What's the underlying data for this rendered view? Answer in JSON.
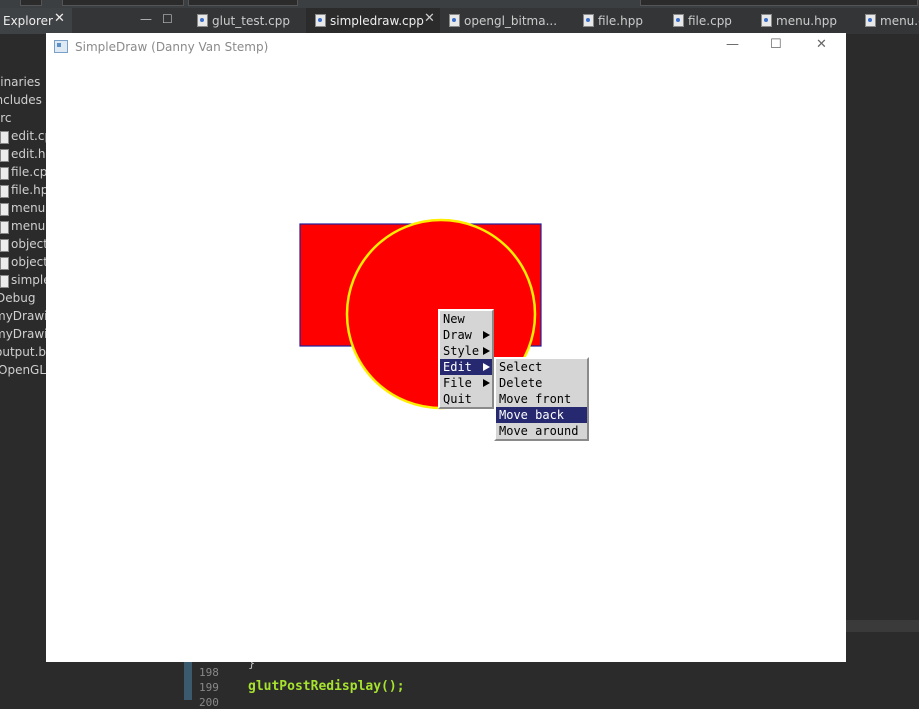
{
  "ide": {
    "explorer_tab": {
      "label": "Explorer"
    },
    "editor_tabs": [
      {
        "label": "glut_test.cpp"
      },
      {
        "label": "simpledraw.cpp",
        "active": true
      },
      {
        "label": "opengl_bitma..."
      },
      {
        "label": "file.hpp"
      },
      {
        "label": "file.cpp"
      },
      {
        "label": "menu.hpp"
      },
      {
        "label": "menu.cpp"
      }
    ],
    "tree_items": [
      {
        "label": "Binaries"
      },
      {
        "label": "Includes"
      },
      {
        "label": "src"
      },
      {
        "label": "edit.cpp"
      },
      {
        "label": "edit.hpp"
      },
      {
        "label": "file.cpp"
      },
      {
        "label": "file.hpp"
      },
      {
        "label": "menu.cpp"
      },
      {
        "label": "menu.hpp"
      },
      {
        "label": "object.cpp"
      },
      {
        "label": "object.hpp"
      },
      {
        "label": "simpledraw.cpp"
      },
      {
        "label": "Debug"
      },
      {
        "label": "myDrawing"
      },
      {
        "label": "myDrawing"
      },
      {
        "label": "output.bmp"
      },
      {
        "label": "OpenGL ("
      }
    ],
    "code": {
      "line_numbers": [
        "198",
        "199",
        "200"
      ],
      "brace": "}",
      "line": "glutPostRedisplay();"
    }
  },
  "window": {
    "title": "SimpleDraw (Danny Van Stemp)",
    "controls": {
      "minimize": "—",
      "maximize": "☐",
      "close": "✕"
    }
  },
  "canvas": {
    "rectangle": {
      "fill": "#ff0000",
      "stroke": "#2020a0"
    },
    "circle": {
      "fill": "#ff0000",
      "stroke": "#ffee00"
    }
  },
  "context_menu": {
    "items": [
      {
        "label": "New",
        "submenu": false,
        "selected": false
      },
      {
        "label": "Draw",
        "submenu": true,
        "selected": false
      },
      {
        "label": "Style",
        "submenu": true,
        "selected": false
      },
      {
        "label": "Edit",
        "submenu": true,
        "selected": true
      },
      {
        "label": "File",
        "submenu": true,
        "selected": false
      },
      {
        "label": "Quit",
        "submenu": false,
        "selected": false
      }
    ]
  },
  "edit_submenu": {
    "items": [
      {
        "label": "Select",
        "selected": false
      },
      {
        "label": "Delete",
        "selected": false
      },
      {
        "label": "Move front",
        "selected": false
      },
      {
        "label": "Move back",
        "selected": true
      },
      {
        "label": "Move around",
        "selected": false
      }
    ]
  },
  "colors": {
    "menu_bg": "#d5d5d5",
    "menu_highlight": "#262870"
  }
}
